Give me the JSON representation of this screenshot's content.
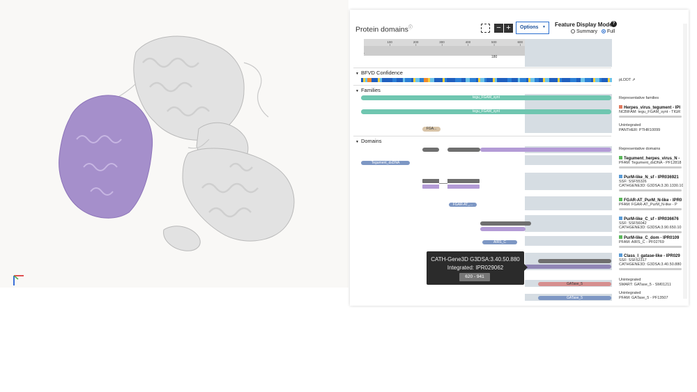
{
  "viewer": {
    "highlight_color": "#a58fcb",
    "protein_color": "#e4e4e4"
  },
  "panel": {
    "title": "Protein domains",
    "info_icon": "info-icon",
    "options_label": "Options",
    "mode_title": "Feature Display Mode",
    "mode_summary": "Summary",
    "mode_full": "Full",
    "selected_mode": "Full"
  },
  "ruler": {
    "start": "1",
    "end": "949",
    "center_label": "180",
    "ticks": [
      "100",
      "200",
      "300",
      "400",
      "500",
      "600",
      "700",
      "800",
      "900"
    ]
  },
  "sections": {
    "bfvd": "BFVD Confidence",
    "plddt": "pLDDT",
    "families": "Families",
    "domains": "Domains"
  },
  "track_labels": {
    "fam1": "tegu_FGAM_synt",
    "fam2": "tegu_FGAM_synt",
    "fam_unint": "FGA...",
    "dom_tegument": "Tegument_dsDNA",
    "dom_fgar": "FGAR-AT_...",
    "dom_airs": "AIRS_C",
    "dom_gatase5a": "GATase_5",
    "dom_gatase5b": "GATase_5"
  },
  "right_labels": {
    "rep_families": "Representative families",
    "herpes_name": "Herpes_virus_tegument - IPI",
    "herpes_sub": "NCBIFAM: tegu_FGAM_synt - TIGR",
    "unint1": "Unintegrated",
    "unint1_sub": "PANTHER: PTHR10099",
    "rep_domains": "Representative domains",
    "teg_name": "Tegument_herpes_virus_N -",
    "teg_sub": "PFAM: Tegument_dsDNA - PF12818",
    "purm_n_name": "PurM-like_N_sf - IPR036921",
    "purm_n_sub1": "SSF: SSF55326",
    "purm_n_sub2": "CATHGENE3D: G3DSA:3.30.1330.10",
    "fgar_name": "FGAR-AT_PurM_N-like - IPR0",
    "fgar_sub": "PFAM: FGAR-AT_PurM_N-like - P",
    "purm_c_sf_name": "PurM-like_C_sf - IPR036676",
    "purm_c_sf_sub1": "SSF: SSF56042",
    "purm_c_sf_sub2": "CATHGENE3D: G3DSA:3.90.650.10",
    "purm_c_dom_name": "PurM-like_C_dom - IPR0109",
    "purm_c_dom_sub": "PFAM: AIRS_C - PF02769",
    "class1_name": "Class_I_gatase-like - IPR029",
    "class1_sub1": "SSF: SSF52317",
    "class1_sub2": "CATHGENE3D: G3DSA:3.40.50.880",
    "unint2": "Unintegrated",
    "unint2_sub": "SMART: GATase_5 - SM01211",
    "unint3": "Unintegrated",
    "unint3_sub": "PFAM: GATase_5 - PF13507"
  },
  "tooltip": {
    "line1": "CATH-Gene3D  G3DSA:3.40.50.880",
    "line2": "Integrated: IPR029062",
    "range": "620 - 941"
  },
  "colors": {
    "teal": "#6fc6b0",
    "purple": "#b39bd6",
    "gray": "#6f6f6f",
    "blue": "#7d97c4",
    "red": "#d68f8f",
    "tan": "#d8c4a8",
    "highlight": "#d6dde3"
  }
}
